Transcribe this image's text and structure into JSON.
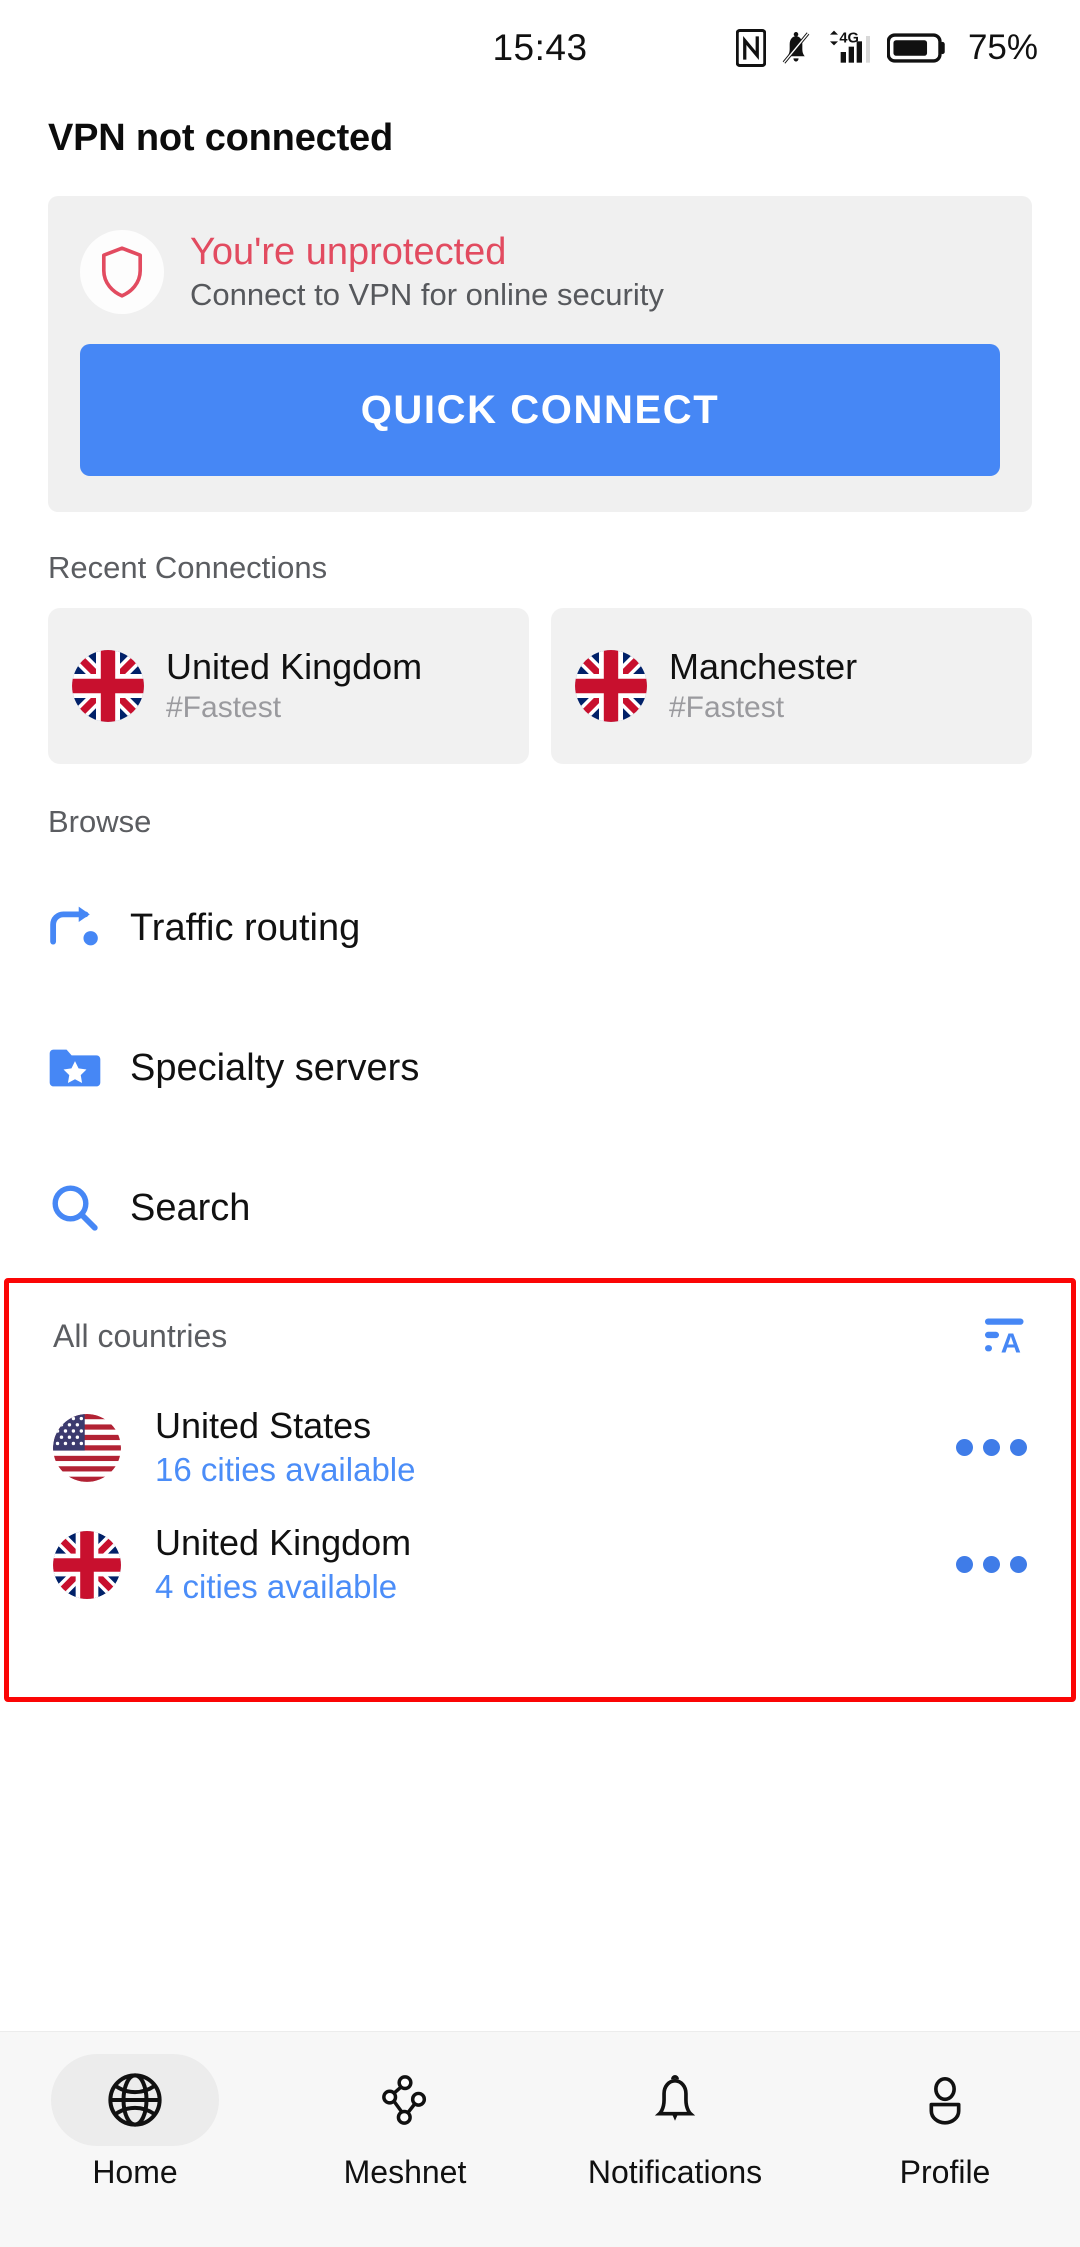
{
  "statusbar": {
    "time": "15:43",
    "battery_percent": "75%",
    "network": "4G",
    "icons": [
      "nfc-icon",
      "bell-muted-icon",
      "signal-4g-icon",
      "battery-icon"
    ]
  },
  "header": {
    "title": "VPN not connected"
  },
  "protection": {
    "status_title": "You're unprotected",
    "status_subtitle": "Connect to VPN for online security",
    "shield_icon": "shield-outline-icon",
    "quick_connect_label": "QUICK CONNECT",
    "accent_red": "#e24b60",
    "accent_blue": "#4687f5"
  },
  "recent": {
    "section_label": "Recent Connections",
    "items": [
      {
        "name": "United Kingdom",
        "tag": "#Fastest",
        "flag": "flag-gb"
      },
      {
        "name": "Manchester",
        "tag": "#Fastest",
        "flag": "flag-gb"
      }
    ]
  },
  "browse": {
    "section_label": "Browse",
    "items": [
      {
        "label": "Traffic routing",
        "icon": "route-arrow-icon"
      },
      {
        "label": "Specialty servers",
        "icon": "folder-star-icon"
      },
      {
        "label": "Search",
        "icon": "search-icon"
      }
    ]
  },
  "countries": {
    "section_label": "All countries",
    "sort_icon": "sort-alphabetical-icon",
    "overflow_icon": "more-horizontal-icon",
    "rows": [
      {
        "name": "United States",
        "cities": "16 cities available",
        "flag": "flag-us"
      },
      {
        "name": "United Kingdom",
        "cities": "4 cities available",
        "flag": "flag-gb"
      }
    ],
    "highlight_color": "#fb0505"
  },
  "bottom_nav": {
    "items": [
      {
        "label": "Home",
        "icon": "globe-icon",
        "active": true
      },
      {
        "label": "Meshnet",
        "icon": "mesh-nodes-icon",
        "active": false
      },
      {
        "label": "Notifications",
        "icon": "bell-icon",
        "active": false
      },
      {
        "label": "Profile",
        "icon": "person-icon",
        "active": false
      }
    ]
  }
}
